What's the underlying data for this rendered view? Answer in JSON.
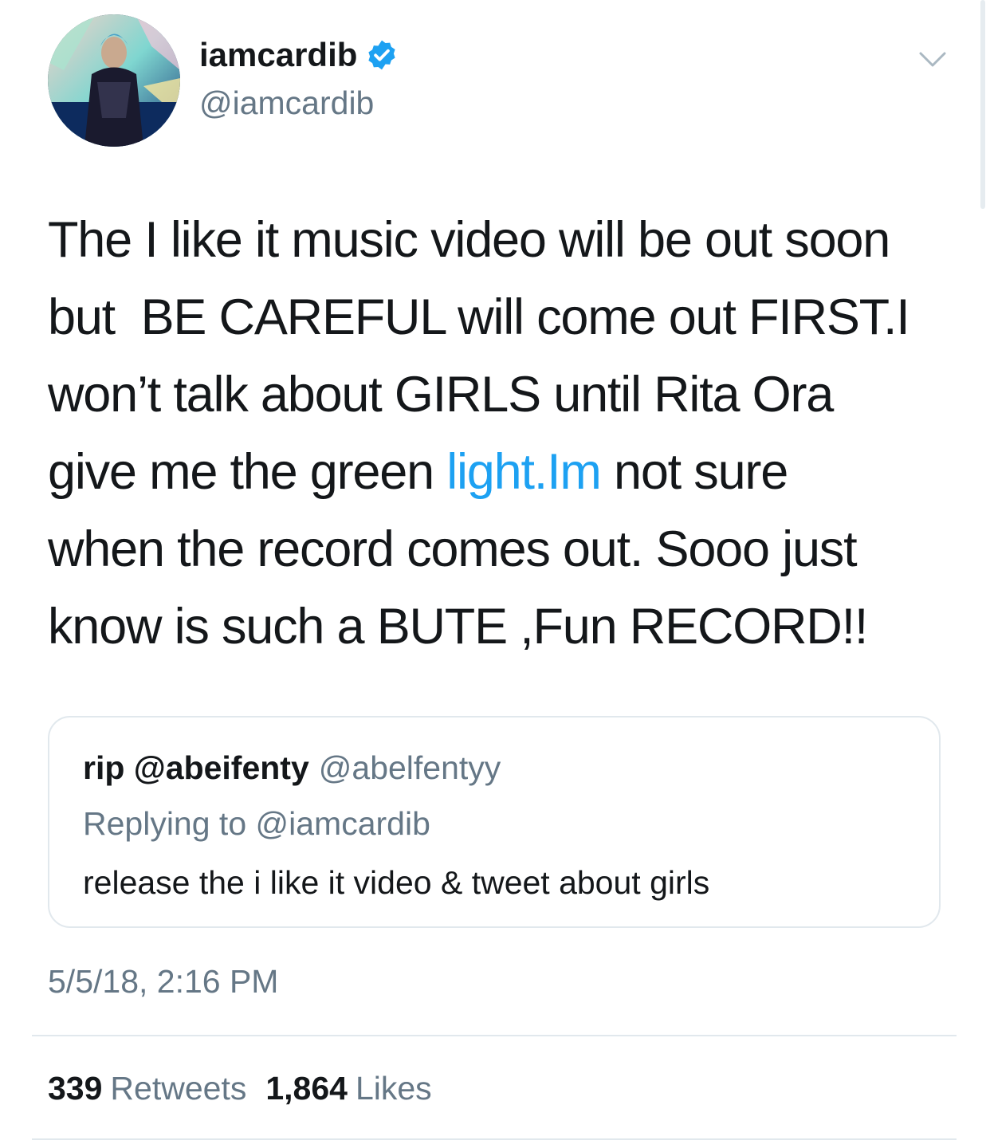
{
  "user": {
    "display_name": "iamcardib",
    "handle": "@iamcardib",
    "verified_icon": "verified-badge-icon"
  },
  "tweet": {
    "lines": [
      {
        "before": "The I like it music video will be out soon"
      },
      {
        "before": "but  BE CAREFUL will come out FIRST.I"
      },
      {
        "before": "won’t talk about GIRLS until Rita Ora"
      },
      {
        "before": "give me the green ",
        "link": "light.Im",
        "after": " not sure"
      },
      {
        "before": "when the record comes out. Sooo just"
      },
      {
        "before": "know is such a BUTE ,Fun RECORD!!"
      }
    ]
  },
  "quoted_tweet": {
    "name": "rip @abeifenty",
    "handle": "@abelfentyy",
    "replying_to": "Replying to @iamcardib",
    "text": "release the i like it video & tweet about girls"
  },
  "timestamp": "5/5/18, 2:16 PM",
  "stats": {
    "retweets_count": "339",
    "retweets_label": "Retweets",
    "likes_count": "1,864",
    "likes_label": "Likes"
  },
  "colors": {
    "text": "#14171a",
    "secondary": "#657786",
    "link": "#1da1f2",
    "border": "#e1e8ed"
  }
}
